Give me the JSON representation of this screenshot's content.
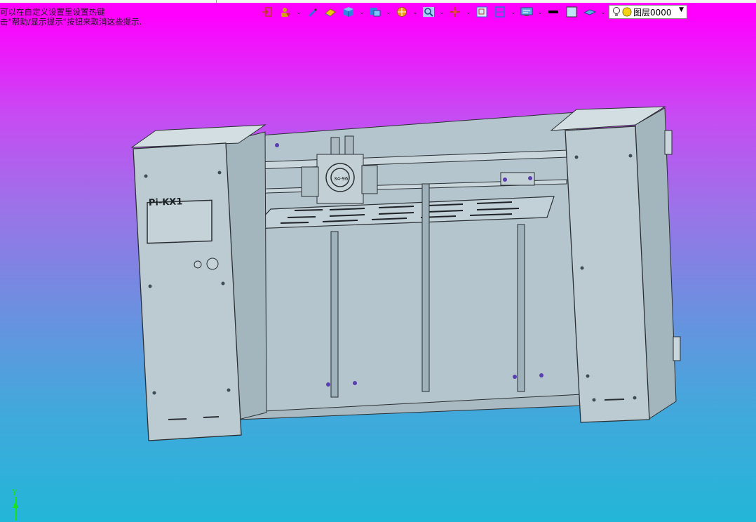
{
  "hint": {
    "line1": "可以在自定义设置里设置热键",
    "line2": "击\"帮助/显示提示\"按钮来取消这些提示."
  },
  "toolbar": {
    "buttons": [
      {
        "name": "exit-icon"
      },
      {
        "name": "user-filter-icon",
        "dropdown": true
      },
      {
        "name": "pencil-icon"
      },
      {
        "name": "eraser-icon",
        "dropdown": true
      },
      {
        "name": "cube-icon",
        "dropdown": true
      },
      {
        "name": "view-orient-icon",
        "dropdown": true
      },
      {
        "name": "render-mode-icon",
        "dropdown": true
      },
      {
        "name": "zoom-icon",
        "dropdown": true
      },
      {
        "name": "pan-icon",
        "dropdown": true
      },
      {
        "name": "zoom-window-icon"
      },
      {
        "name": "frame-icon",
        "dropdown": true
      },
      {
        "name": "monitor-icon",
        "dropdown": true
      },
      {
        "name": "line-weight-icon"
      },
      {
        "name": "color-swatch-icon"
      },
      {
        "name": "plane-icon",
        "dropdown": true
      }
    ],
    "layer": {
      "bulb_icon": "lightbulb-icon",
      "state_icon": "layer-on-icon",
      "label": "图层0000"
    }
  },
  "model": {
    "nameplate": "Pi-KX1",
    "fan_label": "34-96"
  },
  "axis": {
    "label": "Y"
  },
  "colors": {
    "background_top": "#ff00ff",
    "background_bottom": "#22b6d8",
    "model_fill": "#b7c7cf",
    "model_edge": "#2a2f33"
  }
}
